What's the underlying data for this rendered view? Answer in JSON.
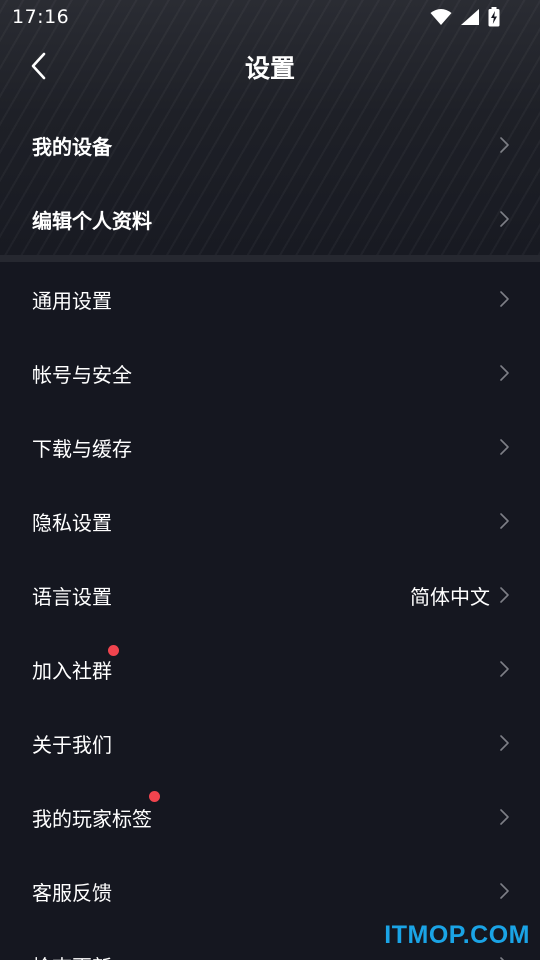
{
  "status_bar": {
    "time": "17:16"
  },
  "nav": {
    "title": "设置"
  },
  "top_section": [
    {
      "label": "我的设备"
    },
    {
      "label": "编辑个人资料"
    }
  ],
  "main_section": [
    {
      "label": "通用设置"
    },
    {
      "label": "帐号与安全"
    },
    {
      "label": "下载与缓存"
    },
    {
      "label": "隐私设置"
    },
    {
      "label": "语言设置",
      "value": "简体中文"
    },
    {
      "label": "加入社群",
      "badge": true
    },
    {
      "label": "关于我们"
    },
    {
      "label": "我的玩家标签",
      "badge": true
    },
    {
      "label": "客服反馈"
    },
    {
      "label": "检查更新"
    }
  ],
  "watermark": "ITMOP.COM",
  "colors": {
    "background": "#151720",
    "badge": "#f0444e",
    "chevron": "#7d7f86",
    "watermark": "#1aa4e6"
  }
}
